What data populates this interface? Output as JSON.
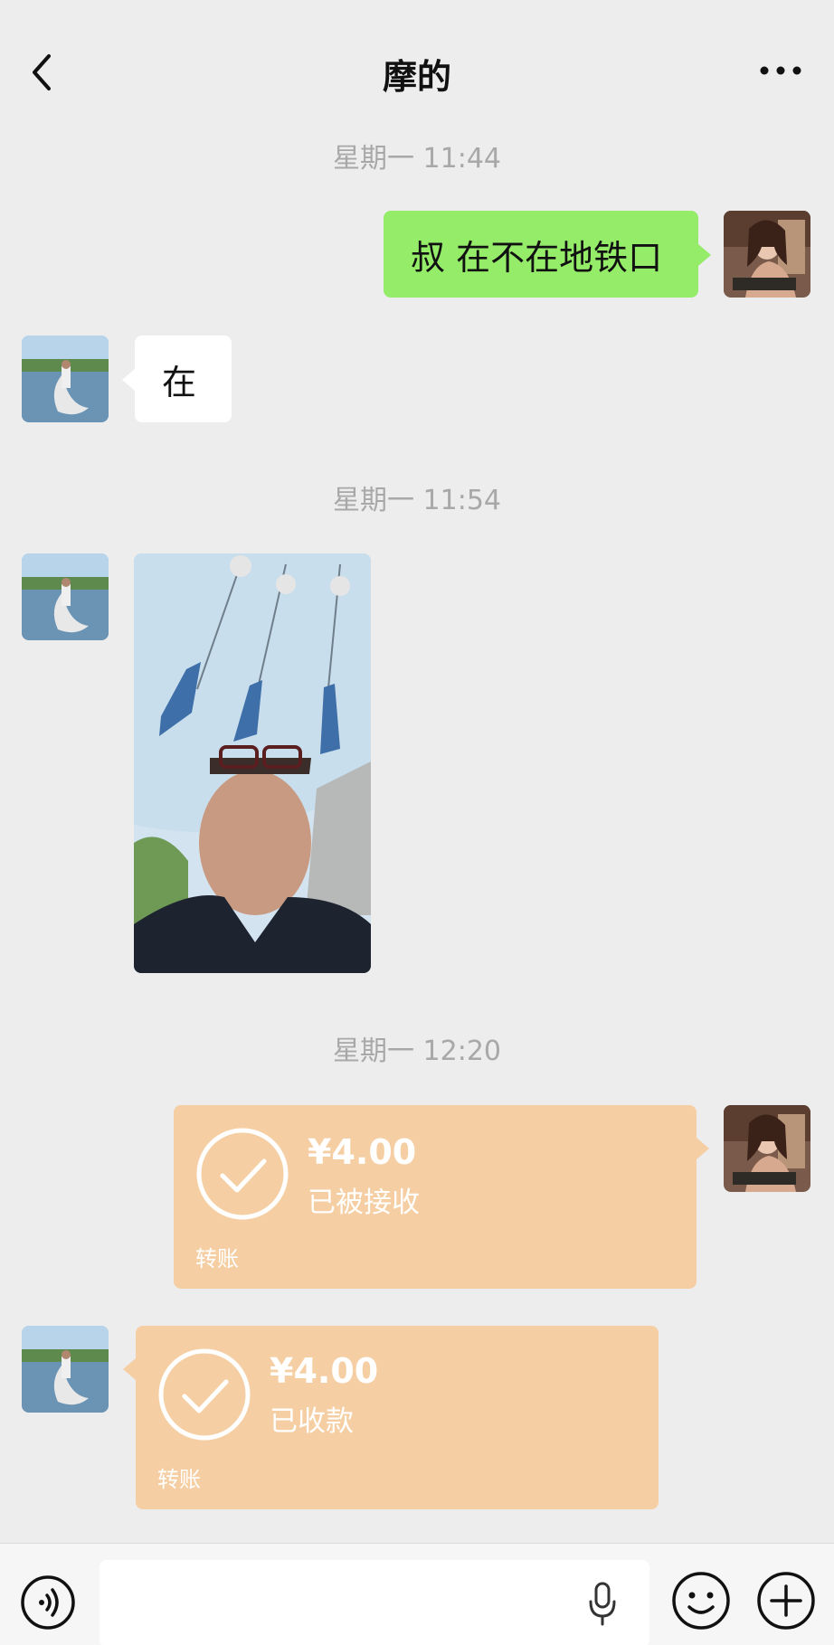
{
  "header": {
    "title": "摩的",
    "back_icon": "chevron-left-icon",
    "more_icon": "more-dots-icon"
  },
  "messages": [
    {
      "type": "timestamp",
      "text": "星期一 11:44"
    },
    {
      "type": "text",
      "from": "self",
      "text": "叔 在不在地铁口"
    },
    {
      "type": "text",
      "from": "peer",
      "text": "在"
    },
    {
      "type": "timestamp",
      "text": "星期一 11:54"
    },
    {
      "type": "image",
      "from": "peer"
    },
    {
      "type": "timestamp",
      "text": "星期一 12:20"
    },
    {
      "type": "transfer",
      "from": "self",
      "amount": "¥4.00",
      "status": "已被接收",
      "label": "转账"
    },
    {
      "type": "transfer",
      "from": "peer",
      "amount": "¥4.00",
      "status": "已收款",
      "label": "转账"
    }
  ],
  "input_bar": {
    "voice_icon": "voice-icon",
    "mic_icon": "microphone-icon",
    "emoji_icon": "emoji-icon",
    "plus_icon": "plus-icon"
  },
  "colors": {
    "background": "#EDEDED",
    "self_bubble": "#95EC69",
    "peer_bubble": "#FFFFFF",
    "transfer_card": "#F5CFA3",
    "timestamp_text": "#A8A8A8"
  }
}
